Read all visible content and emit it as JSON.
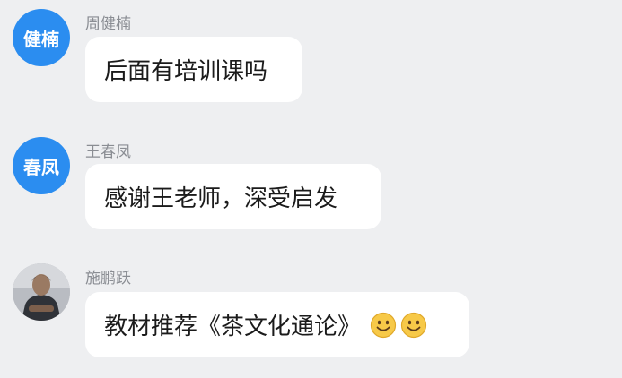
{
  "messages": [
    {
      "avatar_text": "健楠",
      "avatar_color": "#2b8df0",
      "sender": "周健楠",
      "text": "后面有培训课吗"
    },
    {
      "avatar_text": "春凤",
      "avatar_color": "#2b8df0",
      "sender": "王春凤",
      "text": "感谢王老师，深受启发"
    },
    {
      "avatar_type": "photo",
      "sender": "施鹏跃",
      "text": "教材推荐《茶文化通论》",
      "emojis": [
        "smiling-face-emoji",
        "smiling-face-emoji"
      ]
    }
  ],
  "colors": {
    "background": "#eeeff1",
    "bubble": "#ffffff",
    "sender_name": "#8a8d93",
    "message_text": "#1b1b1b"
  }
}
